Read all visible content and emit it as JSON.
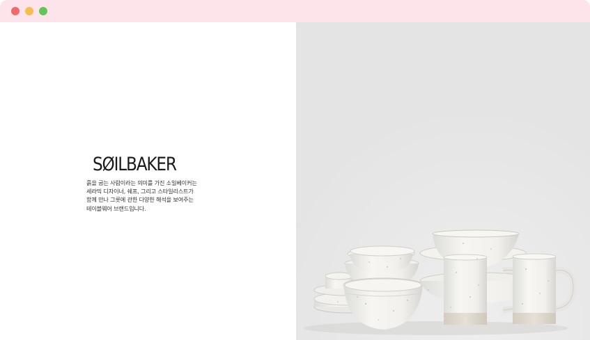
{
  "window": {
    "controls": [
      "close",
      "minimize",
      "maximize"
    ],
    "colors": {
      "titlebar": "#fce4ea",
      "close": "#ef6b6b",
      "minimize": "#f5bd4f",
      "maximize": "#62c555"
    }
  },
  "brand": {
    "logo_text": "SØILBAKER",
    "description": "흙을 굽는 사람이라는 의미를 가진 소일베이커는\n세라믹 디자이너, 쉐프, 그리고 스타일리스트가\n함께 만나 그릇에 관한 다양한 해석을 보여주는\n테이블웨어 브랜드입니다."
  },
  "hero": {
    "image": "speckled-white-ceramic-tableware",
    "background": "#e4e4e4"
  }
}
